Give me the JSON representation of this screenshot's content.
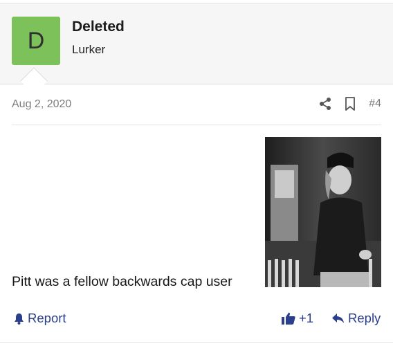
{
  "user": {
    "avatar_letter": "D",
    "name": "Deleted",
    "title": "Lurker",
    "avatar_color": "#7cc159"
  },
  "post": {
    "date": "Aug 2, 2020",
    "number": "#4",
    "text": "Pitt was a fellow backwards cap user",
    "image_alt": "Black and white photo of a man in a backwards cap"
  },
  "actions": {
    "report": "Report",
    "reaction_count": "+1",
    "reply": "Reply"
  },
  "icons": [
    "share-icon",
    "bookmark-icon",
    "bell-icon",
    "thumbs-up-icon",
    "reply-icon"
  ],
  "colors": {
    "link": "#2c3f8d",
    "header_bg": "#f6f6f6",
    "muted_text": "#7b7b7b"
  }
}
